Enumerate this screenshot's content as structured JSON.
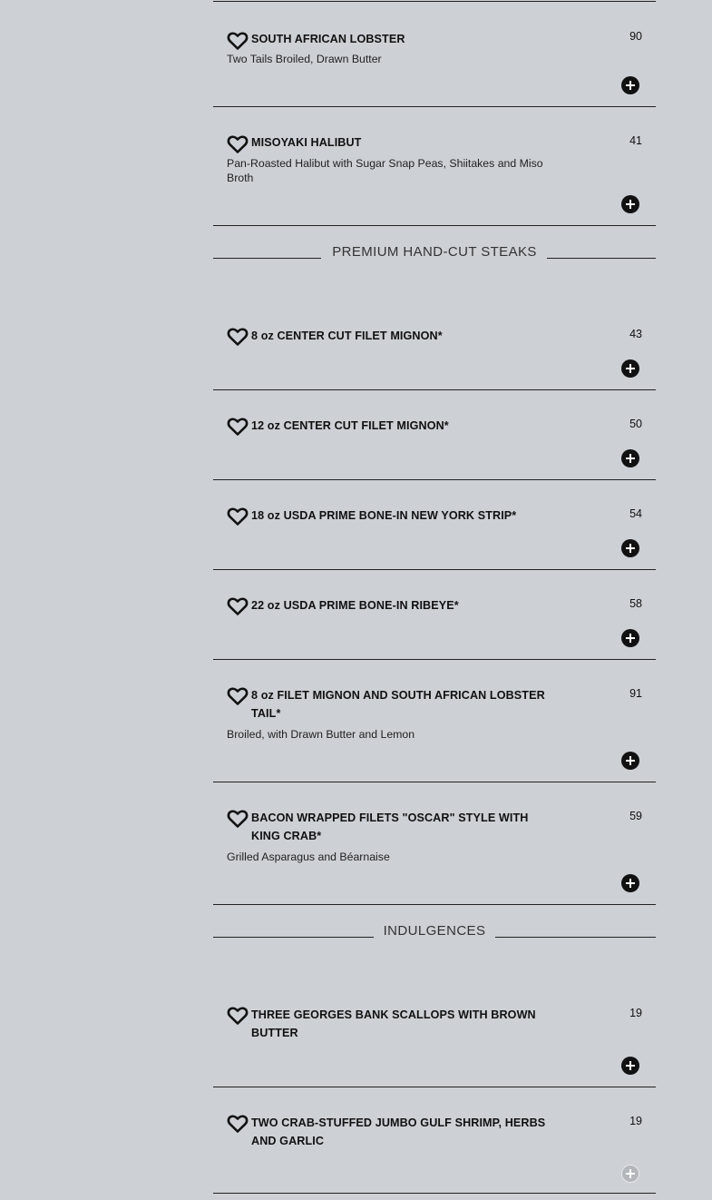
{
  "sections": [
    {
      "title": "",
      "items": [
        {
          "name": "SOUTH AFRICAN LOBSTER",
          "price": "90",
          "desc": "Two Tails Broiled, Drawn Butter"
        },
        {
          "name": "MISOYAKI HALIBUT",
          "price": "41",
          "desc": "Pan-Roasted Halibut with Sugar Snap Peas, Shiitakes and Miso Broth"
        }
      ]
    },
    {
      "title": "PREMIUM HAND-CUT STEAKS",
      "items": [
        {
          "name": "8 oz CENTER CUT FILET MIGNON*",
          "price": "43",
          "desc": ""
        },
        {
          "name": "12 oz CENTER CUT FILET MIGNON*",
          "price": "50",
          "desc": ""
        },
        {
          "name": "18 oz USDA PRIME BONE-IN NEW YORK STRIP*",
          "price": "54",
          "desc": ""
        },
        {
          "name": "22 oz USDA PRIME BONE-IN RIBEYE*",
          "price": "58",
          "desc": ""
        },
        {
          "name": "8 oz FILET MIGNON AND SOUTH AFRICAN LOBSTER TAIL*",
          "price": "91",
          "desc": "Broiled, with Drawn Butter and Lemon"
        },
        {
          "name": "BACON WRAPPED FILETS \"OSCAR\" STYLE WITH KING CRAB*",
          "price": "59",
          "desc": "Grilled Asparagus and Béarnaise"
        }
      ]
    },
    {
      "title": "INDULGENCES",
      "items": [
        {
          "name": "THREE GEORGES BANK SCALLOPS WITH BROWN BUTTER",
          "price": "19",
          "desc": ""
        },
        {
          "name": "TWO CRAB-STUFFED JUMBO GULF SHRIMP, HERBS AND GARLIC",
          "price": "19",
          "desc": "",
          "add_disabled": true
        }
      ]
    }
  ]
}
